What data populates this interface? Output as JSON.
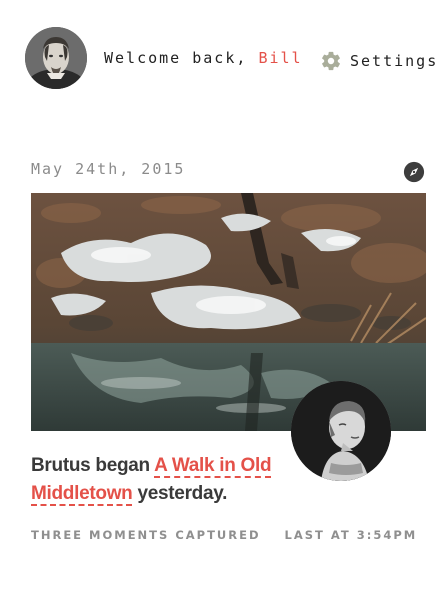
{
  "header": {
    "welcome_prefix": "Welcome back,",
    "user_name": "Bill",
    "settings_label": "Settings",
    "settings_icon": "gear-icon"
  },
  "post": {
    "date": "May 24th, 2015",
    "action_icon": "compass-icon",
    "author": "Brutus",
    "verb": "began",
    "walk_title_line1": "A Walk in Old",
    "walk_title_line2": "Middletown",
    "suffix": "yesterday.",
    "moments": "THREE MOMENTS CAPTURED",
    "last_at": "LAST AT 3:54PM"
  },
  "colors": {
    "accent": "#e45149",
    "text_dark": "#3a3a3a",
    "text_muted": "#8f8f8f",
    "icon_gray": "#a9ad9a"
  }
}
